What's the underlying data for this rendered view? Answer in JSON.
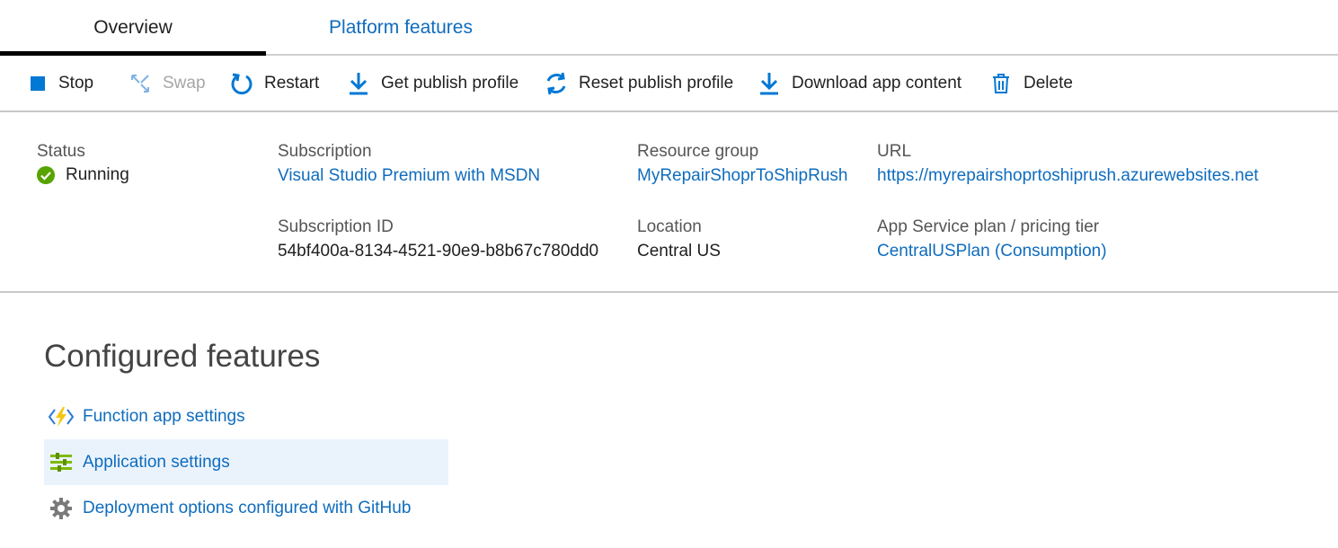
{
  "tabs": [
    {
      "label": "Overview",
      "active": true
    },
    {
      "label": "Platform features",
      "active": false
    }
  ],
  "toolbar": {
    "stop": "Stop",
    "swap": "Swap",
    "restart": "Restart",
    "get_publish_profile": "Get publish profile",
    "reset_publish_profile": "Reset publish profile",
    "download_app_content": "Download app content",
    "delete": "Delete"
  },
  "essentials": {
    "status": {
      "label": "Status",
      "value": "Running"
    },
    "subscription": {
      "label": "Subscription",
      "value": "Visual Studio Premium with MSDN"
    },
    "resource_group": {
      "label": "Resource group",
      "value": "MyRepairShoprToShipRush"
    },
    "url": {
      "label": "URL",
      "value": "https://myrepairshoprtoshiprush.azurewebsites.net"
    },
    "subscription_id": {
      "label": "Subscription ID",
      "value": "54bf400a-8134-4521-90e9-b8b67c780dd0"
    },
    "location": {
      "label": "Location",
      "value": "Central US"
    },
    "app_service_plan": {
      "label": "App Service plan / pricing tier",
      "value": "CentralUSPlan (Consumption)"
    }
  },
  "configured_features": {
    "title": "Configured features",
    "items": [
      {
        "label": "Function app settings",
        "icon": "function-app-icon"
      },
      {
        "label": "Application settings",
        "icon": "app-settings-icon",
        "highlighted": true
      },
      {
        "label": "Deployment options configured with GitHub",
        "icon": "gear-icon"
      }
    ]
  },
  "colors": {
    "link": "#0f6cbd",
    "accent_blue": "#0078d4",
    "running_green": "#57a300",
    "highlight": "#eaf3fc",
    "disabled": "#a6a6a6"
  }
}
